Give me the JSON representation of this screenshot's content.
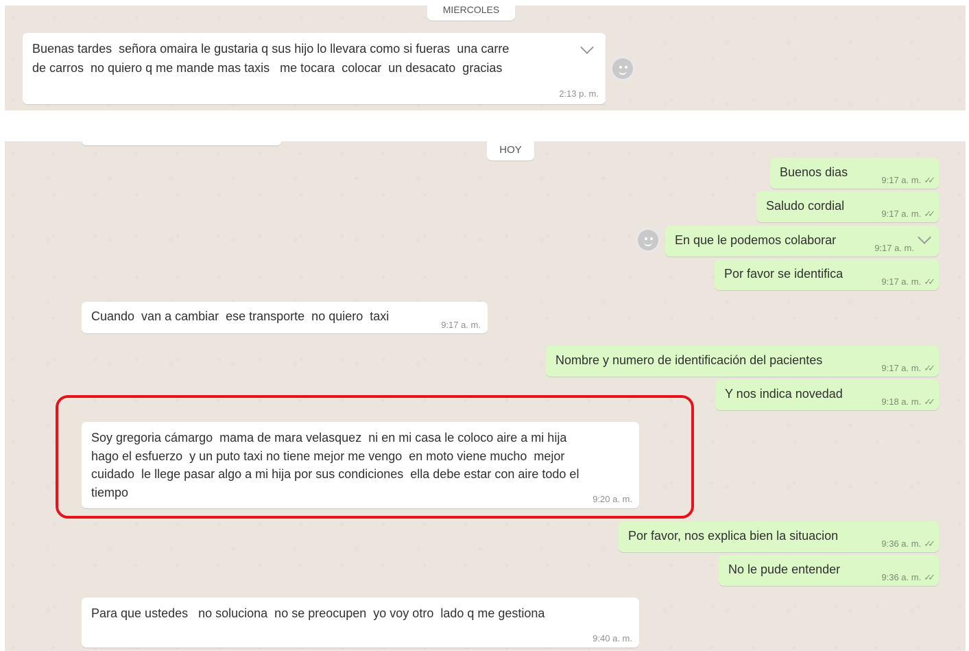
{
  "top_panel": {
    "date_label": "MIÉRCOLES",
    "message": {
      "line1": "Buenas tardes  señora omaira le gustaria q sus hijo lo llevara como si fueras  una carre",
      "line2": "de carros  no quiero q me mande mas taxis   me tocara  colocar  un desacato  gracias",
      "time": "2:13 p. m."
    }
  },
  "bottom_panel": {
    "date_label": "HOY",
    "messages": [
      {
        "text": "Buenos dias",
        "time": "9:17 a. m.",
        "direction": "out"
      },
      {
        "text": "Saludo cordial",
        "time": "9:17 a. m.",
        "direction": "out"
      },
      {
        "text": "En que le podemos colaborar",
        "time": "9:17 a. m.",
        "direction": "out"
      },
      {
        "text": "Por favor se identifica",
        "time": "9:17 a. m.",
        "direction": "out"
      },
      {
        "text": "Cuando  van a cambiar  ese transporte  no quiero  taxi",
        "time": "9:17 a. m.",
        "direction": "in"
      },
      {
        "text": "Nombre y numero de identificación del pacientes",
        "time": "9:17 a. m.",
        "direction": "out"
      },
      {
        "text": "Y nos indica novedad",
        "time": "9:18 a. m.",
        "direction": "out"
      },
      {
        "lines": [
          "Soy gregoria cámargo  mama de mara velasquez  ni en mi casa le coloco aire a mi hija",
          "hago el esfuerzo  y un puto taxi no tiene mejor me vengo  en moto viene mucho  mejor",
          "cuidado  le llege pasar algo a mi hija por sus condiciones  ella debe estar con aire todo el",
          "tiempo"
        ],
        "time": "9:20 a. m.",
        "direction": "in",
        "highlighted": true
      },
      {
        "text": "Por favor, nos explica bien la situacion",
        "time": "9:36 a. m.",
        "direction": "out"
      },
      {
        "text": "No le pude entender",
        "time": "9:36 a. m.",
        "direction": "out"
      },
      {
        "text": "Para que ustedes   no soluciona  no se preocupen  yo voy otro  lado q me gestiona",
        "time": "9:40 a. m.",
        "direction": "in"
      }
    ]
  },
  "icons": {
    "emoji": "smiley-face-icon",
    "menu": "chevron-down-icon",
    "read_receipt": "double-check-icon"
  },
  "colors": {
    "chat_background": "#ece5dd",
    "outgoing_bubble": "#dcf8c6",
    "incoming_bubble": "#ffffff",
    "annotation": "#e3141b"
  }
}
